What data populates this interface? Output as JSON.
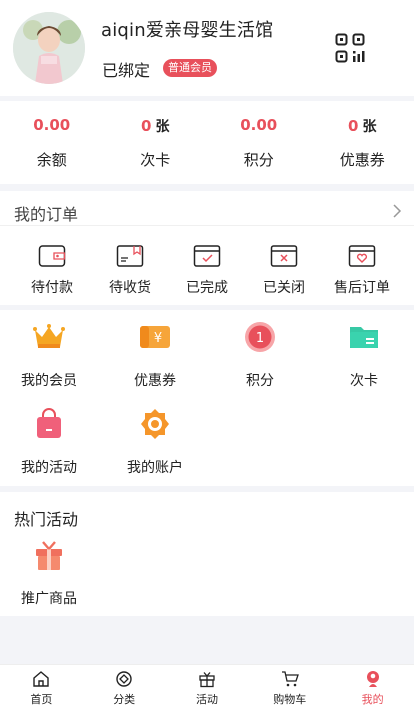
{
  "header": {
    "store_name": "aiqin爱亲母婴生活馆",
    "bind_status": "已绑定",
    "member_level": "普通会员",
    "qr_icon": "qr-code-icon"
  },
  "stats": [
    {
      "value": "0.00",
      "unit": "",
      "label": "余额"
    },
    {
      "value": "0",
      "unit": "张",
      "label": "次卡"
    },
    {
      "value": "0.00",
      "unit": "",
      "label": "积分"
    },
    {
      "value": "0",
      "unit": "张",
      "label": "优惠券"
    }
  ],
  "orders": {
    "title": "我的订单",
    "items": [
      {
        "label": "待付款",
        "icon": "wallet-icon"
      },
      {
        "label": "待收货",
        "icon": "package-icon"
      },
      {
        "label": "已完成",
        "icon": "order-done-icon"
      },
      {
        "label": "已关闭",
        "icon": "order-closed-icon"
      },
      {
        "label": "售后订单",
        "icon": "after-sale-icon"
      }
    ]
  },
  "services": [
    {
      "label": "我的会员",
      "icon": "crown-icon"
    },
    {
      "label": "优惠券",
      "icon": "coupon-icon"
    },
    {
      "label": "积分",
      "icon": "points-medal-icon"
    },
    {
      "label": "次卡",
      "icon": "card-folder-icon"
    },
    {
      "label": "我的活动",
      "icon": "shopping-bag-icon"
    },
    {
      "label": "我的账户",
      "icon": "account-gear-icon"
    }
  ],
  "hot": {
    "title": "热门活动",
    "items": [
      {
        "label": "推广商品",
        "icon": "gift-box-icon"
      }
    ]
  },
  "tabbar": [
    {
      "label": "首页",
      "icon": "home-icon"
    },
    {
      "label": "分类",
      "icon": "category-icon"
    },
    {
      "label": "活动",
      "icon": "gift-icon"
    },
    {
      "label": "购物车",
      "icon": "cart-icon"
    },
    {
      "label": "我的",
      "icon": "user-icon",
      "active": true
    }
  ],
  "colors": {
    "accent": "#e8505b",
    "background": "#f3f4f8"
  }
}
